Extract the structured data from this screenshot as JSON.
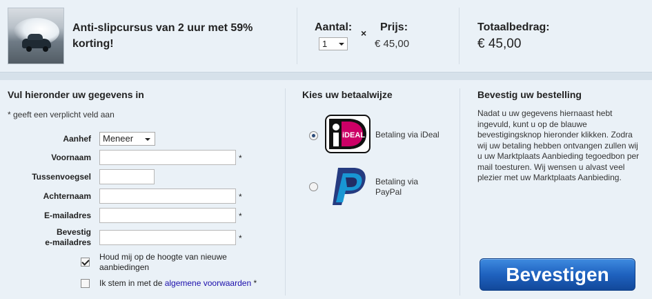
{
  "product": {
    "title": "Anti-slipcursus van 2 uur met 59% korting!",
    "image_icon": "product-photo-car-icon"
  },
  "order": {
    "quantity_label": "Aantal:",
    "quantity_value": "1",
    "times_sign": "×",
    "price_label": "Prijs:",
    "price_value": "€ 45,00",
    "total_label": "Totaalbedrag:",
    "total_value": "€ 45,00"
  },
  "form": {
    "title": "Vul hieronder uw gegevens in",
    "required_hint": "* geeft een verplicht veld aan",
    "required_mark": "*",
    "fields": {
      "aanhef_label": "Aanhef",
      "aanhef_value": "Meneer",
      "voornaam_label": "Voornaam",
      "tussenvoegsel_label": "Tussenvoegsel",
      "achternaam_label": "Achternaam",
      "email_label": "E-mailadres",
      "confirm_email_label_line1": "Bevestig",
      "confirm_email_label_line2": "e-mailadres"
    },
    "newsletter_text": "Houd mij op de hoogte van nieuwe aanbiedingen",
    "terms_prefix": "Ik stem in met de ",
    "terms_link": "algemene voorwaarden",
    "terms_suffix": " *"
  },
  "payment": {
    "title": "Kies uw betaalwijze",
    "options": [
      {
        "label": "Betaling via iDeal",
        "logo_text": "iDEAL",
        "selected": true
      },
      {
        "label": "Betaling via PayPal",
        "logo_text": "",
        "selected": false
      }
    ]
  },
  "confirm": {
    "title": "Bevestig uw bestelling",
    "text": "Nadat u uw gegevens hiernaast hebt ingevuld, kunt u op de blauwe bevestigingsknop hieronder klikken. Zodra wij uw betaling hebben ontvangen zullen wij u uw Marktplaats Aanbieding tegoedbon per mail toesturen. Wij wensen u alvast veel plezier met uw Marktplaats Aanbieding.",
    "button_label": "Bevestigen"
  },
  "colors": {
    "background": "#eaf1f7",
    "button": "#1f62bf",
    "link": "#1a0dab",
    "ideal_pink": "#cc0066",
    "paypal_dark": "#253b80",
    "paypal_light": "#179bd7"
  }
}
